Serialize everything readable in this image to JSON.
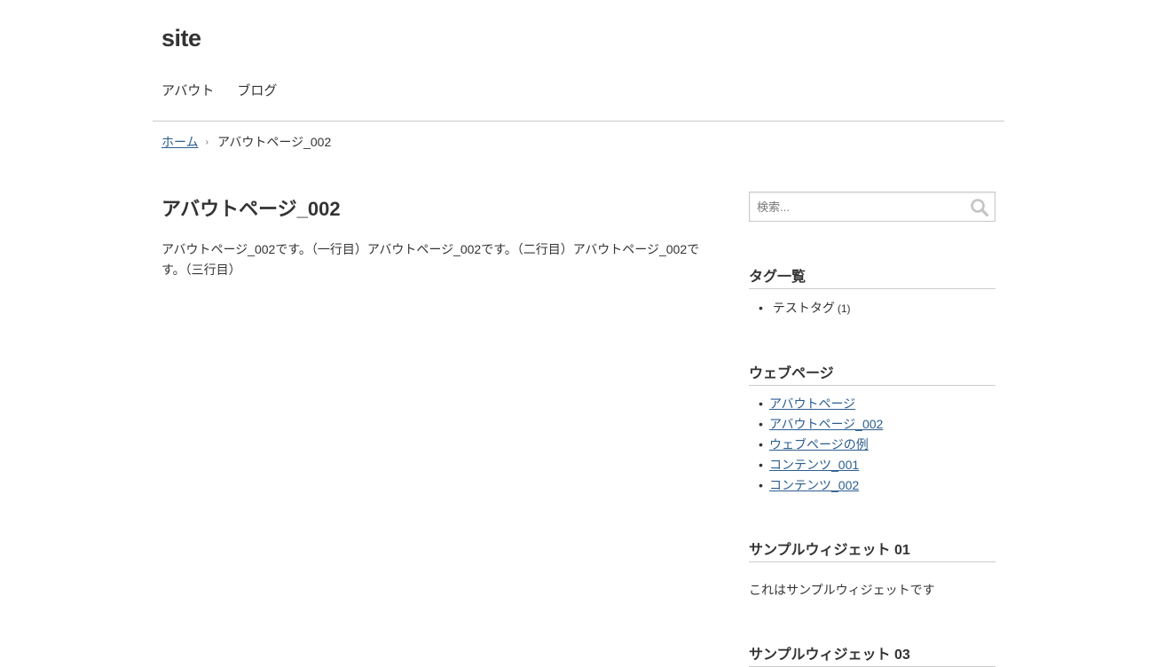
{
  "header": {
    "site_title": "site",
    "nav": [
      {
        "label": "アバウト"
      },
      {
        "label": "ブログ"
      }
    ]
  },
  "breadcrumb": {
    "home": "ホーム",
    "separator": "›",
    "current": "アバウトページ_002"
  },
  "main": {
    "title": "アバウトページ_002",
    "body": "アバウトページ_002です。（一行目）アバウトページ_002です。（二行目）アバウトページ_002です。（三行目）"
  },
  "sidebar": {
    "search": {
      "placeholder": "検索..."
    },
    "tags": {
      "title": "タグ一覧",
      "items": [
        {
          "label": "テストタグ",
          "count": "(1)"
        }
      ]
    },
    "webpages": {
      "title": "ウェブページ",
      "items": [
        {
          "label": "アバウトページ"
        },
        {
          "label": "アバウトページ_002"
        },
        {
          "label": "ウェブページの例"
        },
        {
          "label": "コンテンツ_001"
        },
        {
          "label": "コンテンツ_002"
        }
      ]
    },
    "widget01": {
      "title": "サンプルウィジェット 01",
      "text": "これはサンプルウィジェットです"
    },
    "widget03": {
      "title": "サンプルウィジェット 03"
    }
  },
  "colors": {
    "link": "#2b5d8f",
    "text": "#333333",
    "rule": "#cccccc"
  },
  "icons": {
    "search": "search-icon"
  }
}
